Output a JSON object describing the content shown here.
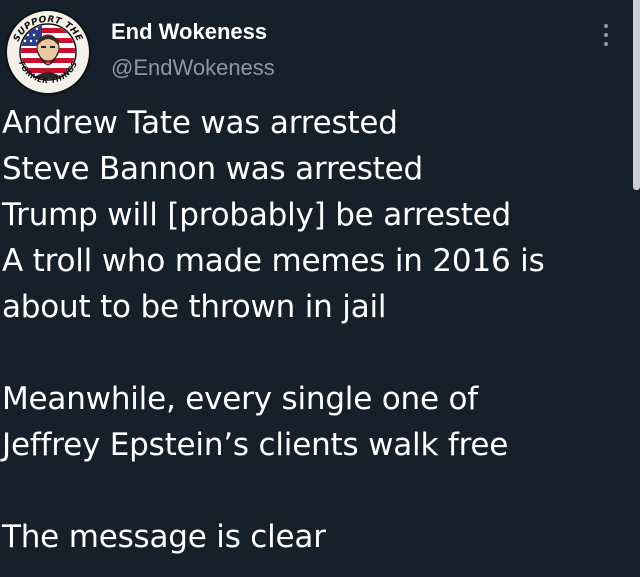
{
  "author": {
    "display_name": "End Wokeness",
    "handle": "@EndWokeness",
    "avatar_text_top": "SUPPORT THE",
    "avatar_text_bottom": "FORMER THINGS"
  },
  "tweet": {
    "lines": [
      "Andrew Tate was arrested",
      "Steve Bannon was arrested",
      "Trump will [probably] be arrested",
      "A troll who made memes in 2016 is",
      "about to be thrown in jail",
      "",
      "Meanwhile, every single one of",
      "Jeffrey Epstein’s clients walk free",
      "",
      "The message is clear"
    ]
  },
  "icons": {
    "more": "more-vertical-icon"
  },
  "colors": {
    "background": "#15202b",
    "primary_text": "#ffffff",
    "secondary_text": "#8b98a5"
  }
}
